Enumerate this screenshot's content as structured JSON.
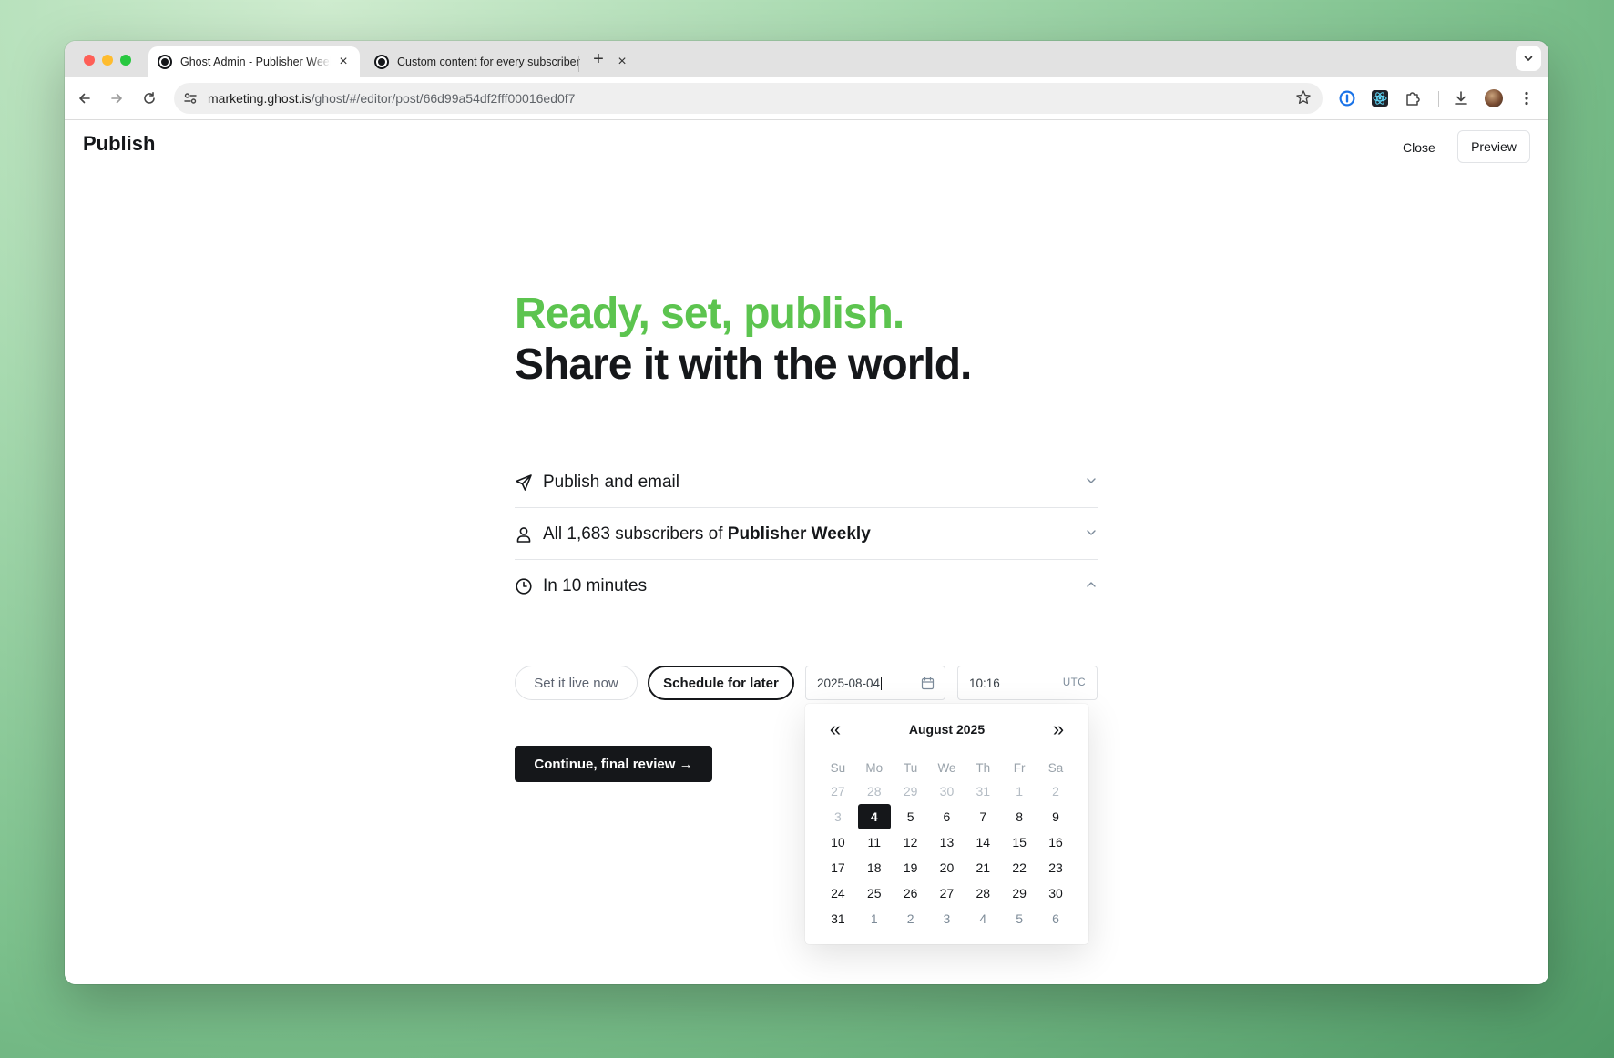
{
  "browser": {
    "tabs": [
      {
        "title": "Ghost Admin - Publisher Weekly",
        "active": true
      },
      {
        "title": "Custom content for every subscriber",
        "active": false
      }
    ],
    "url_host": "marketing.ghost.is",
    "url_path": "/ghost/#/editor/post/66d99a54df2fff00016ed0f7"
  },
  "header": {
    "title": "Publish",
    "close_label": "Close",
    "preview_label": "Preview"
  },
  "hero": {
    "line1": "Ready, set, publish.",
    "line2": "Share it with the world."
  },
  "options": {
    "publish_type": "Publish and email",
    "audience_prefix": "All 1,683 subscribers of ",
    "audience_name": "Publisher Weekly",
    "timing": "In 10 minutes"
  },
  "schedule": {
    "live_now_label": "Set it live now",
    "later_label": "Schedule for later",
    "date_value": "2025-08-04",
    "time_value": "10:16",
    "timezone": "UTC"
  },
  "continue_label": "Continue, final review →",
  "datepicker": {
    "prev": "«",
    "next": "»",
    "month_label": "August 2025",
    "weekdays": [
      "Su",
      "Mo",
      "Tu",
      "We",
      "Th",
      "Fr",
      "Sa"
    ],
    "selected": "4",
    "weeks": [
      [
        "27",
        "28",
        "29",
        "30",
        "31",
        "1",
        "2"
      ],
      [
        "3",
        "4",
        "5",
        "6",
        "7",
        "8",
        "9"
      ],
      [
        "10",
        "11",
        "12",
        "13",
        "14",
        "15",
        "16"
      ],
      [
        "17",
        "18",
        "19",
        "20",
        "21",
        "22",
        "23"
      ],
      [
        "24",
        "25",
        "26",
        "27",
        "28",
        "29",
        "30"
      ],
      [
        "31",
        "1",
        "2",
        "3",
        "4",
        "5",
        "6"
      ]
    ]
  },
  "colors": {
    "accent_green": "#5cc44f",
    "ink": "#15171a"
  }
}
